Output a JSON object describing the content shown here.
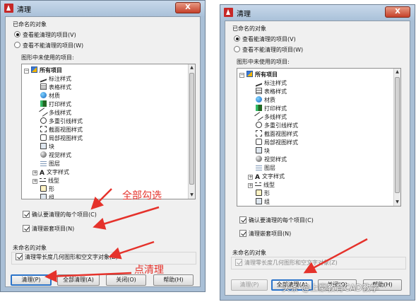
{
  "dialog": {
    "title": "清理",
    "close_glyph": "X",
    "named_objects_label": "已命名的对象",
    "radio_view_purgeable": "查看能清理的项目(V)",
    "radio_view_nonpurgeable": "查看不能清理的项目(W)",
    "unused_items_label": "图形中未使用的项目:",
    "tree": {
      "root": "所有项目",
      "items": [
        "标注样式",
        "表格样式",
        "材质",
        "打印样式",
        "多线样式",
        "多重引线样式",
        "截面视图样式",
        "局部视图样式",
        "块",
        "视觉样式",
        "图层",
        "文字样式",
        "线型",
        "形",
        "组"
      ]
    },
    "confirm_each_label": "确认要清理的每个项目(C)",
    "purge_nested_label": "清理嵌套项目(N)",
    "unnamed_objects_label": "未命名的对象",
    "purge_zero_geometry_label": "清理零长度几何图形和空文字对象(Z)",
    "buttons": {
      "purge": "清理(P)",
      "purge_all": "全部清理(A)",
      "close": "关闭(O)",
      "help": "帮助(H)"
    }
  },
  "annotations": {
    "select_all": "全部勾选",
    "click_purge": "点清理"
  },
  "watermark": "头条 @上豪教育CAD教学",
  "colors": {
    "annotation_red": "#e5322b",
    "focus_blue": "#2c74c9",
    "window_frame": "#a9bfd6",
    "dialog_background": "#f0f0f0"
  }
}
